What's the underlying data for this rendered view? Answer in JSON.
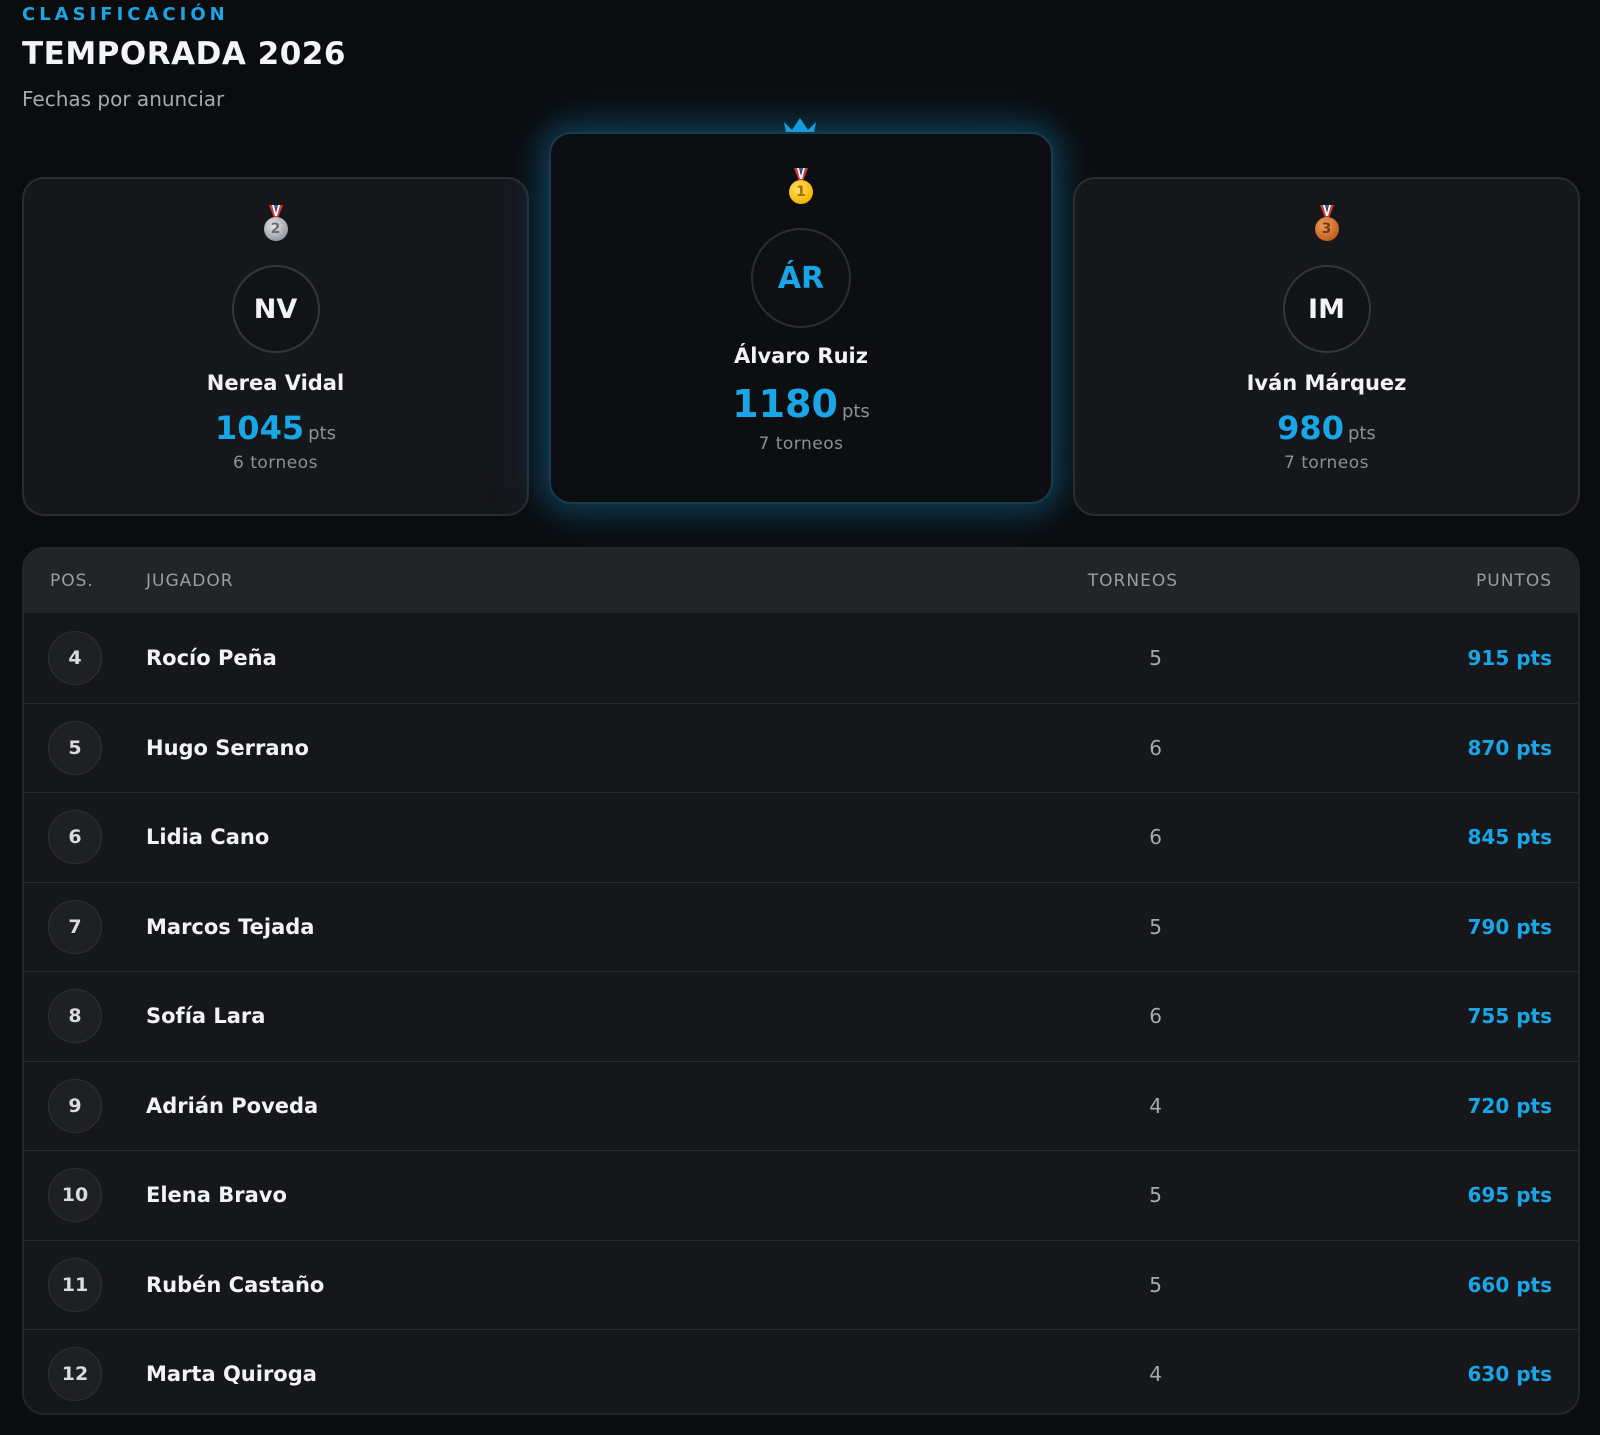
{
  "header": {
    "eyebrow": "CLASIFICACIÓN",
    "title": "TEMPORADA 2026",
    "subtitle": "Fechas por anunciar"
  },
  "colors": {
    "accent": "#1aa6e6",
    "background": "#0b0c0e",
    "card": "#16171b"
  },
  "podium": {
    "first": {
      "medal": "1",
      "icon": "gold-medal-icon",
      "initials": "ÁR",
      "name": "Álvaro Ruiz",
      "points": "1180",
      "unit": "pts",
      "tournaments": "7 torneos"
    },
    "second": {
      "medal": "2",
      "icon": "silver-medal-icon",
      "initials": "NV",
      "name": "Nerea Vidal",
      "points": "1045",
      "unit": "pts",
      "tournaments": "6 torneos"
    },
    "third": {
      "medal": "3",
      "icon": "bronze-medal-icon",
      "initials": "IM",
      "name": "Iván Márquez",
      "points": "980",
      "unit": "pts",
      "tournaments": "7 torneos"
    }
  },
  "table": {
    "headers": {
      "pos": "POS.",
      "player": "JUGADOR",
      "tournaments": "TORNEOS",
      "points": "PUNTOS"
    },
    "rows": [
      {
        "pos": "4",
        "player": "Rocío Peña",
        "tournaments": "5",
        "points": "915 pts"
      },
      {
        "pos": "5",
        "player": "Hugo Serrano",
        "tournaments": "6",
        "points": "870 pts"
      },
      {
        "pos": "6",
        "player": "Lidia Cano",
        "tournaments": "6",
        "points": "845 pts"
      },
      {
        "pos": "7",
        "player": "Marcos Tejada",
        "tournaments": "5",
        "points": "790 pts"
      },
      {
        "pos": "8",
        "player": "Sofía Lara",
        "tournaments": "6",
        "points": "755 pts"
      },
      {
        "pos": "9",
        "player": "Adrián Poveda",
        "tournaments": "4",
        "points": "720 pts"
      },
      {
        "pos": "10",
        "player": "Elena Bravo",
        "tournaments": "5",
        "points": "695 pts"
      },
      {
        "pos": "11",
        "player": "Rubén Castaño",
        "tournaments": "5",
        "points": "660 pts"
      },
      {
        "pos": "12",
        "player": "Marta Quiroga",
        "tournaments": "4",
        "points": "630 pts"
      }
    ]
  }
}
